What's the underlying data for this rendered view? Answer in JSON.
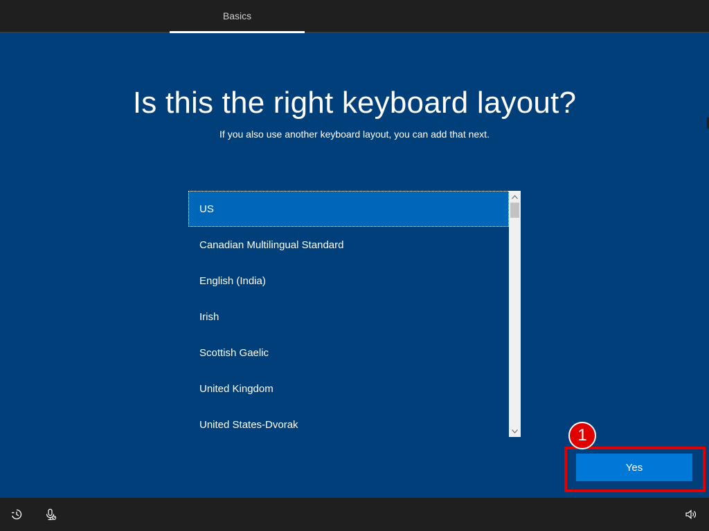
{
  "header": {
    "tab_label": "Basics"
  },
  "main": {
    "title": "Is this the right keyboard layout?",
    "subtitle": "If you also use another keyboard layout, you can add that next."
  },
  "layouts": {
    "selected": "US",
    "items": [
      "US",
      "Canadian Multilingual Standard",
      "English (India)",
      "Irish",
      "Scottish Gaelic",
      "United Kingdom",
      "United States-Dvorak"
    ]
  },
  "actions": {
    "yes_label": "Yes",
    "step_number": "1"
  },
  "footer": {
    "icons": [
      "ease-of-access-icon",
      "microphone-icon",
      "volume-icon"
    ]
  },
  "colors": {
    "background": "#003f79",
    "selected_item": "#0067b8",
    "button": "#0078d7",
    "annotation": "#e00000",
    "bar": "#1f1f1f"
  }
}
